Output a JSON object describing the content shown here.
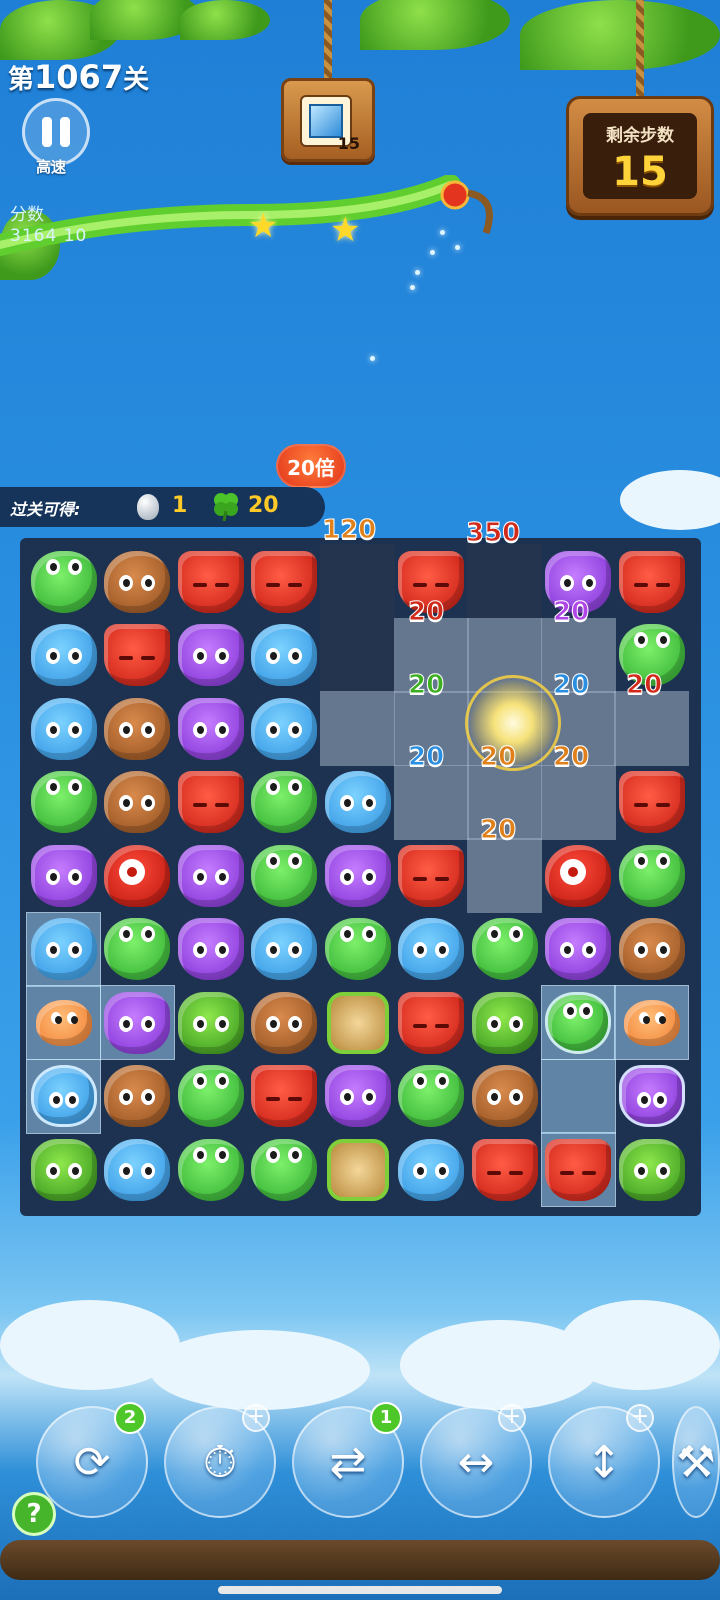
{
  "header": {
    "level_prefix": "第",
    "level_number": "1067",
    "level_suffix": "关",
    "speed_label": "高速",
    "score_label": "分数",
    "score_value": "3164 10",
    "stars_earned": 2
  },
  "goal": {
    "icon": "ice-tile-icon",
    "count": "15"
  },
  "moves": {
    "label": "剩余步数",
    "value": "15"
  },
  "reward": {
    "label": "过关可得:",
    "egg_count": "1",
    "clover_count": "20",
    "multiplier": "20倍"
  },
  "board": {
    "columns": 9,
    "rows": 9,
    "cells": [
      [
        "frog",
        "bear",
        "fox",
        "fox",
        "empty",
        "fox",
        "empty",
        "owl",
        "fox"
      ],
      [
        "hippo",
        "fox",
        "owl",
        "hippo",
        "empty",
        "clear",
        "clear",
        "clear",
        "frog"
      ],
      [
        "hippo",
        "bear",
        "owl",
        "hippo",
        "clear",
        "clear",
        "clear",
        "clear",
        "clear"
      ],
      [
        "frog",
        "bear",
        "fox",
        "frog",
        "hippo",
        "clear",
        "clear",
        "clear",
        "fox"
      ],
      [
        "owl",
        "cyclops",
        "owl",
        "frog",
        "owl",
        "fox",
        "clear",
        "cyclops",
        "frog"
      ],
      [
        "hippo-ice",
        "frog",
        "owl",
        "hippo",
        "frog",
        "hippo",
        "frog",
        "owl",
        "bear"
      ],
      [
        "puffer-ice",
        "owl-ice",
        "bush",
        "bear",
        "leaf",
        "fox",
        "bush",
        "frog-bubble-ice",
        "puffer-ice"
      ],
      [
        "hippo-bubble-ice",
        "bear",
        "frog",
        "fox",
        "owl",
        "frog",
        "bear",
        "ice",
        "owl-bubble"
      ],
      [
        "bush",
        "hippo",
        "frog",
        "frog",
        "leaf",
        "hippo",
        "fox",
        "fox-ice",
        "bush"
      ]
    ],
    "score_popups": [
      {
        "text": "120",
        "color": "orange"
      },
      {
        "text": "350",
        "color": "red"
      },
      {
        "text": "20",
        "color": "red"
      },
      {
        "text": "20",
        "color": "purple"
      },
      {
        "text": "20",
        "color": "green"
      },
      {
        "text": "20",
        "color": "blue"
      },
      {
        "text": "20",
        "color": "red"
      },
      {
        "text": "20",
        "color": "blue"
      },
      {
        "text": "20",
        "color": "orange"
      },
      {
        "text": "20",
        "color": "orange"
      },
      {
        "text": "20",
        "color": "orange"
      }
    ]
  },
  "boosters": [
    {
      "name": "shuffle-booster",
      "icon": "shuffle-icon",
      "count": "2"
    },
    {
      "name": "time-booster",
      "icon": "clock-icon",
      "count": "+"
    },
    {
      "name": "swap-booster",
      "icon": "swap-icon",
      "count": "1"
    },
    {
      "name": "horizontal-rocket-booster",
      "icon": "horizontal-rocket-icon",
      "count": "+"
    },
    {
      "name": "vertical-rocket-booster",
      "icon": "vertical-rocket-icon",
      "count": "+"
    },
    {
      "name": "hammer-booster",
      "icon": "hammer-icon",
      "count": ""
    }
  ],
  "help": {
    "label": "?"
  },
  "colors": {
    "sky": "#2a8fe0",
    "board_bg": "#1d3250",
    "moves_value": "#ffd43b",
    "reward_value": "#ffc928"
  }
}
